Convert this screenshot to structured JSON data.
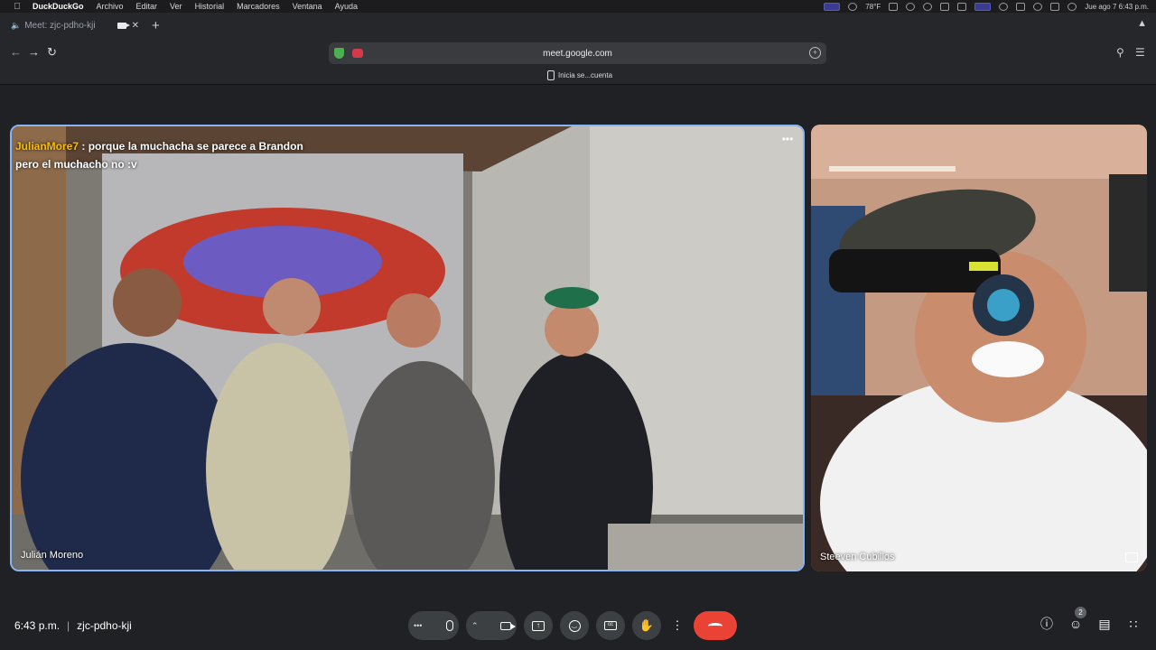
{
  "menubar": {
    "items": [
      "DuckDuckGo",
      "Archivo",
      "Editar",
      "Ver",
      "Historial",
      "Marcadores",
      "Ventana",
      "Ayuda"
    ],
    "weather": "78°F",
    "datetime": "Jue ago 7  6:43 p.m."
  },
  "tab": {
    "title": "Meet: zjc-pdho-kji"
  },
  "toolbar": {
    "url": "meet.google.com"
  },
  "bookmarks": {
    "item": "Inicia se...cuenta"
  },
  "meeting": {
    "main_participant": "Julián Moreno",
    "side_participant": "Steeven Cubillos",
    "caption": {
      "speaker": "JulianMore7",
      "line1": " : porque la muchacha se parece a Brandon",
      "line2": "pero el muchacho no :v"
    },
    "time": "6:43 p.m.",
    "code": "zjc-pdho-kji",
    "people_count": "2"
  },
  "colors": {
    "accent_border": "#8ab4f8",
    "end_call": "#ea4335",
    "caption_name": "#fbbc04",
    "control_bg": "#3c4043"
  }
}
